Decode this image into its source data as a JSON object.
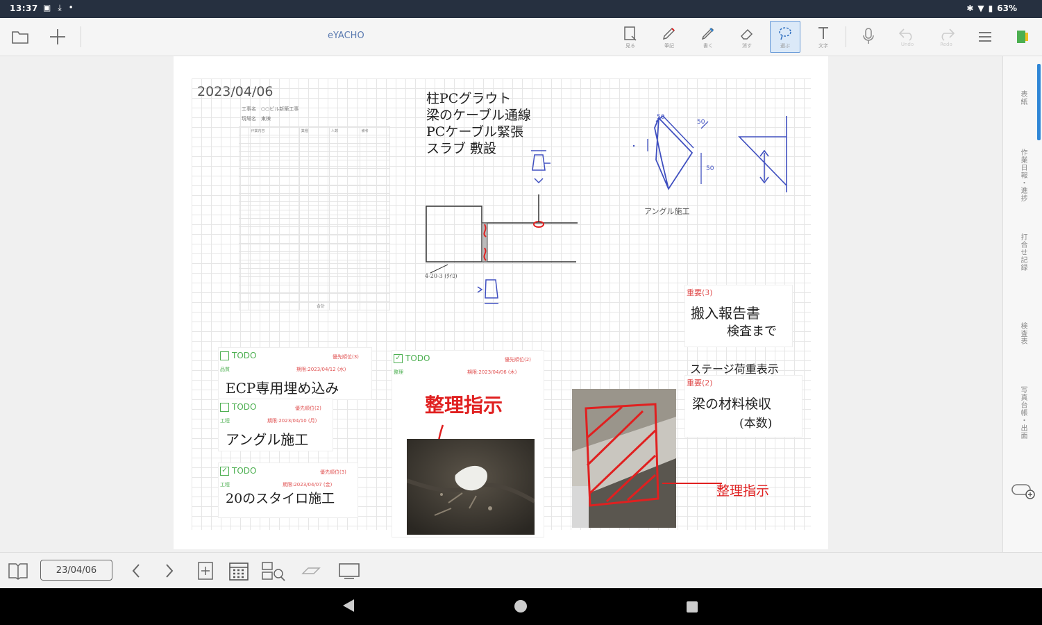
{
  "status": {
    "time": "13:37",
    "battery": "63%"
  },
  "toolbar": {
    "title": "eYACHO",
    "tools": [
      {
        "label": "見る"
      },
      {
        "label": "筆記"
      },
      {
        "label": "書く"
      },
      {
        "label": "消す"
      },
      {
        "label": "選ぶ"
      },
      {
        "label": "文字"
      }
    ],
    "undo_label": "Undo",
    "redo_label": "Redo"
  },
  "note": {
    "date": "2023/04/06",
    "sheet": {
      "header1": "工事名　○○ビル新築工事",
      "header2": "現場名　東棟",
      "columns": [
        "",
        "作業内容",
        "業種",
        "人数",
        "備考"
      ],
      "total_label": "合計"
    },
    "handwriting": {
      "tasks": [
        "柱PCグラウト",
        "梁のケーブル通線",
        "PCケーブル緊張",
        "スラブ 敷設"
      ],
      "detail_label": "4-20-3 (ﾀｲﾛ)",
      "angle_label": "アングル施工",
      "dims": [
        "50",
        "50",
        "50"
      ],
      "important1_label": "重要(3)",
      "important1_text1": "搬入報告書",
      "important1_text2": "検査まで",
      "stage_text": "ステージ荷重表示",
      "important2_label": "重要(2)",
      "important2_text1": "梁の材料検収",
      "important2_text2": "(本数)",
      "seiri1": "整理指示",
      "seiri2": "整理指示"
    },
    "todos": [
      {
        "title": "TODO",
        "priority": "優先順位(3)",
        "tag": "品質",
        "due": "期限:2023/04/12 (水)",
        "text": "ECP専用埋め込み",
        "checked": false
      },
      {
        "title": "TODO",
        "priority": "優先順位(2)",
        "tag": "工程",
        "due": "期限:2023/04/10 (月)",
        "text": "アングル施工",
        "checked": false
      },
      {
        "title": "TODO",
        "priority": "優先順位(3)",
        "tag": "工程",
        "due": "期限:2023/04/07 (金)",
        "text": "20のスタイロ施工",
        "checked": true
      },
      {
        "title": "TODO",
        "priority": "優先順位(2)",
        "tag": "整理",
        "due": "期限:2023/04/06 (木)",
        "text": "",
        "checked": true
      }
    ]
  },
  "right_panel": {
    "tabs": [
      "表紙",
      "作業日報・進捗",
      "打合せ記録",
      "検査表",
      "写真台帳・出面"
    ]
  },
  "bottom": {
    "date_value": "23/04/06"
  }
}
